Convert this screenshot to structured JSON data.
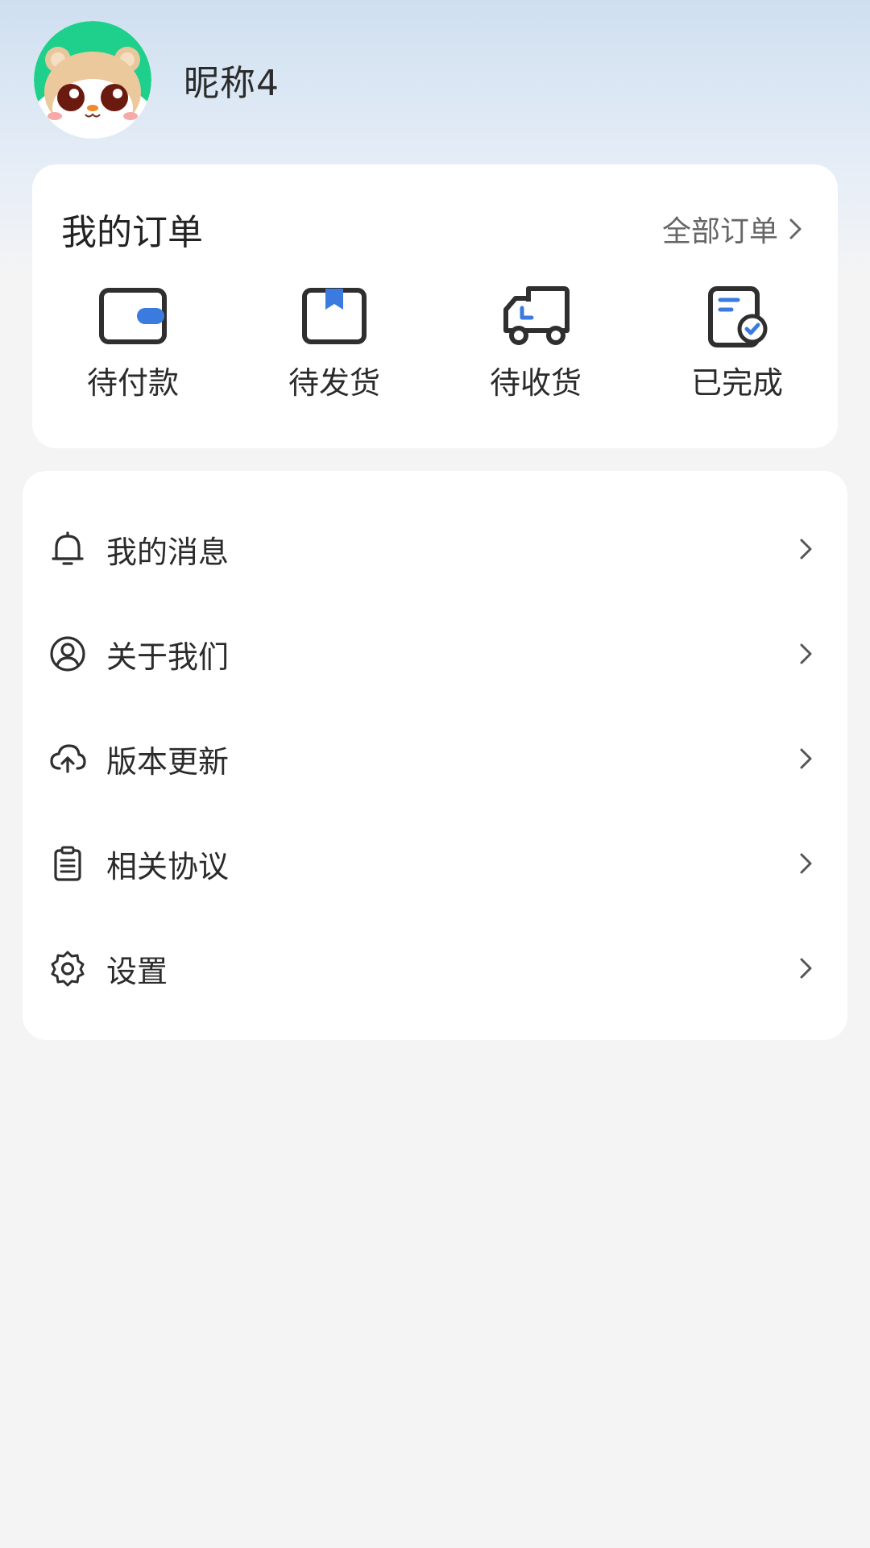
{
  "profile": {
    "nickname": "昵称4",
    "avatar_icon": "cartoon-hamster-avatar"
  },
  "orders": {
    "title": "我的订单",
    "all_label": "全部订单",
    "items": [
      {
        "label": "待付款",
        "icon": "wallet-icon"
      },
      {
        "label": "待发货",
        "icon": "package-icon"
      },
      {
        "label": "待收货",
        "icon": "truck-icon"
      },
      {
        "label": "已完成",
        "icon": "document-check-icon"
      }
    ]
  },
  "menu": {
    "items": [
      {
        "label": "我的消息",
        "icon": "bell-icon"
      },
      {
        "label": "关于我们",
        "icon": "user-circle-icon"
      },
      {
        "label": "版本更新",
        "icon": "cloud-upload-icon"
      },
      {
        "label": "相关协议",
        "icon": "clipboard-icon"
      },
      {
        "label": "设置",
        "icon": "gear-icon"
      }
    ]
  },
  "colors": {
    "accent": "#3b7be0",
    "icon_stroke": "#2f2f2f",
    "background": "#f4f4f5"
  }
}
